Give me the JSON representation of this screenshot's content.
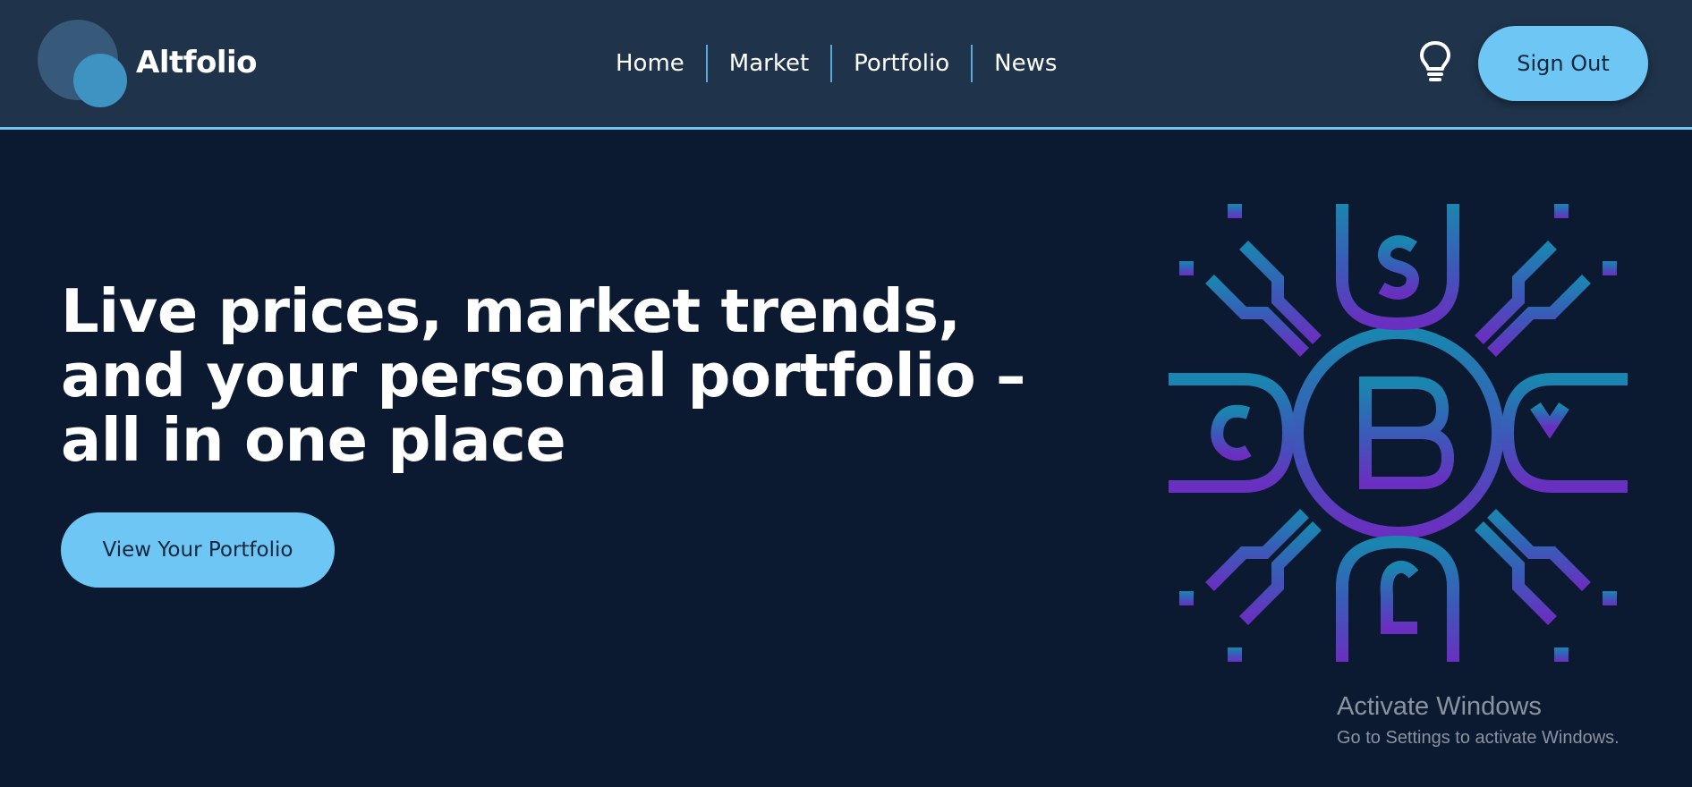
{
  "header": {
    "logo_text": "Altfolio",
    "nav": [
      {
        "label": "Home"
      },
      {
        "label": "Market"
      },
      {
        "label": "Portfolio"
      },
      {
        "label": "News"
      }
    ],
    "theme_icon": "lightbulb-icon",
    "sign_out_label": "Sign Out"
  },
  "hero": {
    "title": "Live prices, market trends, and your personal portfolio – all in one place",
    "cta_label": "View Your Portfolio",
    "illustration_icon": "crypto-currency-circuit-icon"
  },
  "watermark": {
    "title": "Activate Windows",
    "subtitle": "Go to Settings to activate Windows."
  },
  "colors": {
    "background": "#0b1931",
    "header": "#1f334a",
    "accent": "#6ec6f5",
    "illustration_top": "#1a86b0",
    "illustration_bottom": "#6a2fc0"
  }
}
